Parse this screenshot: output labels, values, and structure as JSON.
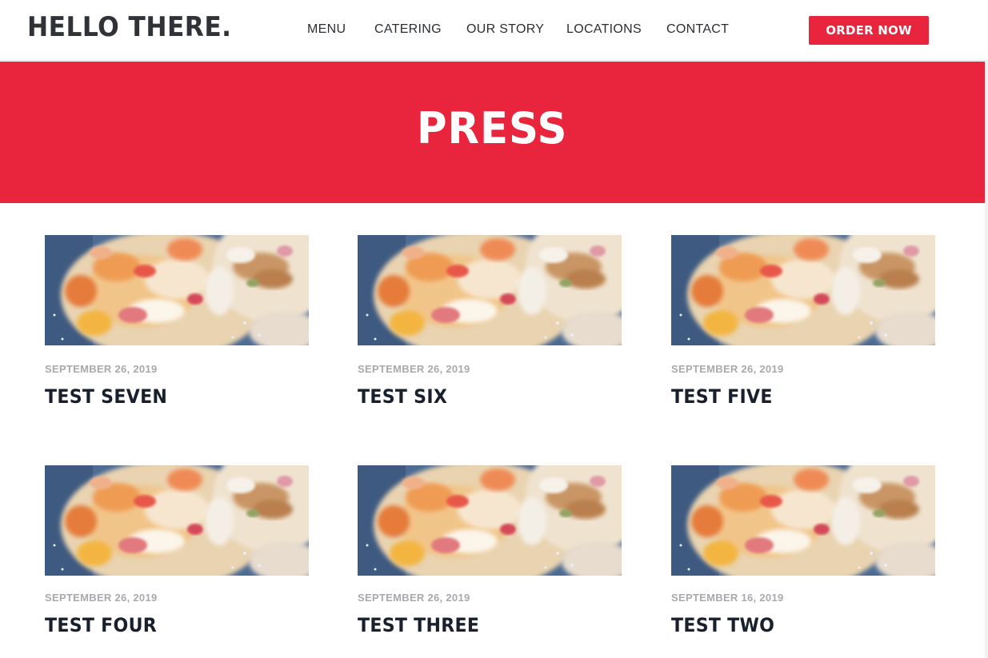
{
  "header": {
    "logo": "HELLO THERE.",
    "nav": [
      {
        "label": "MENU"
      },
      {
        "label": "CATERING"
      },
      {
        "label": "OUR STORY"
      },
      {
        "label": "LOCATIONS"
      },
      {
        "label": "CONTACT"
      }
    ],
    "order_button": "ORDER NOW"
  },
  "hero": {
    "title": "PRESS"
  },
  "posts": [
    {
      "date": "SEPTEMBER 26, 2019",
      "title": "TEST SEVEN",
      "image": "tacos-photo"
    },
    {
      "date": "SEPTEMBER 26, 2019",
      "title": "TEST SIX",
      "image": "tacos-photo"
    },
    {
      "date": "SEPTEMBER 26, 2019",
      "title": "TEST FIVE",
      "image": "tacos-photo"
    },
    {
      "date": "SEPTEMBER 26, 2019",
      "title": "TEST FOUR",
      "image": "tacos-photo"
    },
    {
      "date": "SEPTEMBER 26, 2019",
      "title": "TEST THREE",
      "image": "tacos-photo"
    },
    {
      "date": "SEPTEMBER 16, 2019",
      "title": "TEST TWO",
      "image": "tacos-photo"
    }
  ],
  "colors": {
    "accent": "#e8253c",
    "text_dark": "#17202c",
    "date_gray": "#a7a9ad"
  }
}
